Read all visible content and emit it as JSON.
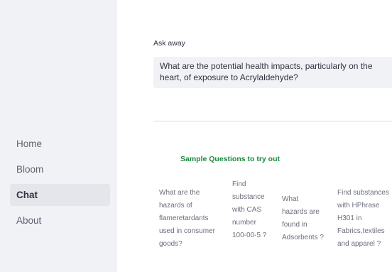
{
  "sidebar": {
    "items": [
      {
        "label": "Home",
        "active": false
      },
      {
        "label": "Bloom",
        "active": false
      },
      {
        "label": "Chat",
        "active": true
      },
      {
        "label": "About",
        "active": false
      }
    ]
  },
  "main": {
    "ask_label": "Ask away",
    "question_value": "What are the potential health impacts, particularly on the heart, of exposure to Acrylaldehyde?",
    "samples_title": "Sample Questions to try out",
    "sample_questions": [
      "What are the hazards of flameretardants used in consumer goods?",
      "Find substance with CAS number 100-00-5 ?",
      "What hazards are found in Adsorbents ?",
      "Find substances with HPhrase H301 in Fabrics,textiles and apparel ?"
    ]
  },
  "colors": {
    "sidebar_bg": "#f0f2f6",
    "accent_green": "#1a8a3a",
    "text_primary": "#31333f",
    "text_muted": "#6c6f7d"
  }
}
